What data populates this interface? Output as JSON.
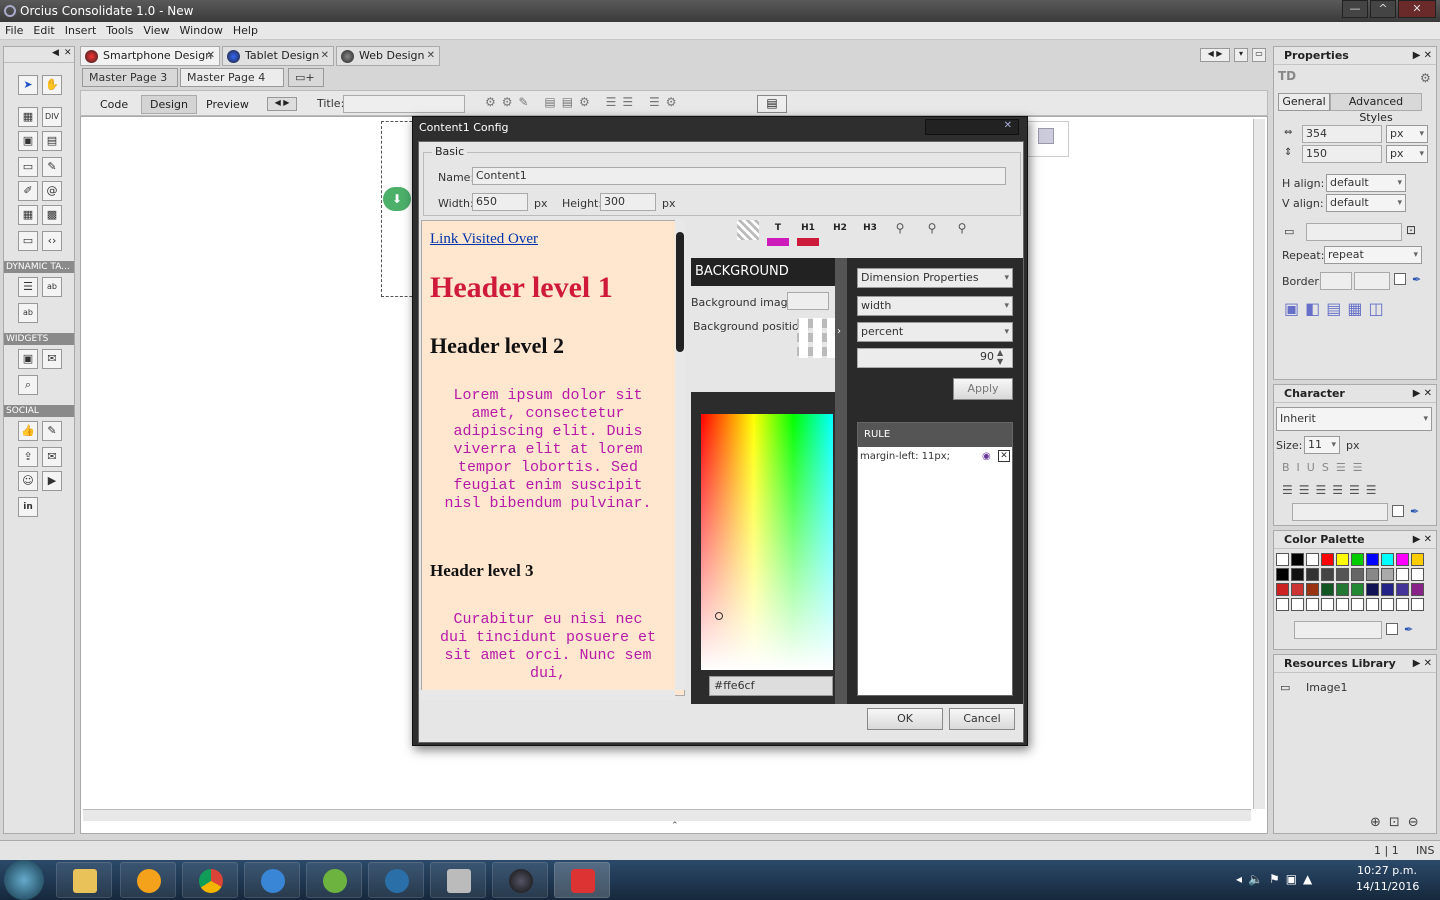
{
  "window": {
    "title": "Orcius Consolidate 1.0 - New"
  },
  "menu": [
    "File",
    "Edit",
    "Insert",
    "Tools",
    "View",
    "Window",
    "Help"
  ],
  "toolbox": {
    "sections": [
      "DYNAMIC TA...",
      "WIDGETS",
      "SOCIAL"
    ]
  },
  "doc_tabs": [
    {
      "label": "Smartphone Design",
      "active": true
    },
    {
      "label": "Tablet Design",
      "active": false
    },
    {
      "label": "Web Design",
      "active": false
    }
  ],
  "master_tabs": [
    "Master Page 3",
    "Master Page 4"
  ],
  "view_modes": {
    "code": "Code",
    "design": "Design",
    "preview": "Preview",
    "title_label": "Title:"
  },
  "dialog": {
    "title": "Content1 Config",
    "basic_legend": "Basic",
    "name_label": "Name:",
    "name_value": "Content1",
    "width_label": "Width:",
    "width_value": "650",
    "height_label": "Height:",
    "height_value": "300",
    "unit": "px",
    "preview": {
      "links": [
        "Link",
        "Visited",
        "Over"
      ],
      "h1": "Header level 1",
      "h2": "Header level 2",
      "p1": "Lorem ipsum dolor sit amet, consectetur adipiscing elit. Duis viverra elit at lorem tempor lobortis. Sed feugiat enim suscipit nisl bibendum pulvinar.",
      "h3": "Header level 3",
      "p2": "Curabitur eu nisi nec dui tincidunt posuere et sit amet orci. Nunc sem dui,"
    },
    "style_buttons": [
      "T",
      "H1",
      "H2",
      "H3"
    ],
    "background": {
      "heading": "BACKGROUND",
      "image_label": "Background image:",
      "position_label": "Background position:",
      "hex": "#ffe6cf"
    },
    "dimension": {
      "category": "Dimension Properties",
      "property": "width",
      "unit": "percent",
      "value": "90",
      "apply": "Apply"
    },
    "rule": {
      "heading": "RULE",
      "entry": "margin-left: 11px;"
    },
    "ok": "OK",
    "cancel": "Cancel"
  },
  "properties": {
    "title": "Properties",
    "element": "TD",
    "tabs": [
      "General",
      "Advanced Styles"
    ],
    "width": "354",
    "height": "150",
    "unit": "px",
    "h_align_label": "H align:",
    "h_align": "default",
    "v_align_label": "V align:",
    "v_align": "default",
    "repeat_label": "Repeat:",
    "repeat": "repeat",
    "border_label": "Border:"
  },
  "character": {
    "title": "Character",
    "font": "Inherit",
    "size_label": "Size:",
    "size": "11",
    "unit": "px"
  },
  "palette": {
    "title": "Color Palette",
    "colors": [
      "#ffffff",
      "#000000",
      "#ffffff",
      "#ff0000",
      "#ffff00",
      "#00cc00",
      "#0000ff",
      "#00ffff",
      "#ff00ff",
      "#ffcc00",
      "#000000",
      "#111111",
      "#333333",
      "#444444",
      "#555555",
      "#666666",
      "#888888",
      "#aaaaaa",
      "#ffffff",
      "#ffffff",
      "#cc2222",
      "#cc3333",
      "#993311",
      "#115522",
      "#227733",
      "#228833",
      "#111155",
      "#222288",
      "#443399",
      "#882288",
      "#ffffff",
      "#ffffff",
      "#ffffff",
      "#ffffff",
      "#ffffff",
      "#ffffff",
      "#ffffff",
      "#ffffff",
      "#ffffff",
      "#ffffff"
    ]
  },
  "resources": {
    "title": "Resources Library",
    "items": [
      "Image1"
    ]
  },
  "status": {
    "page": "1 | 1",
    "mode": "INS"
  },
  "clock": {
    "time": "10:27 p.m.",
    "date": "14/11/2016"
  },
  "colors": {
    "preview_bg": "#ffe6cf",
    "h1": "#d01a3c",
    "para": "#b81aa8"
  }
}
